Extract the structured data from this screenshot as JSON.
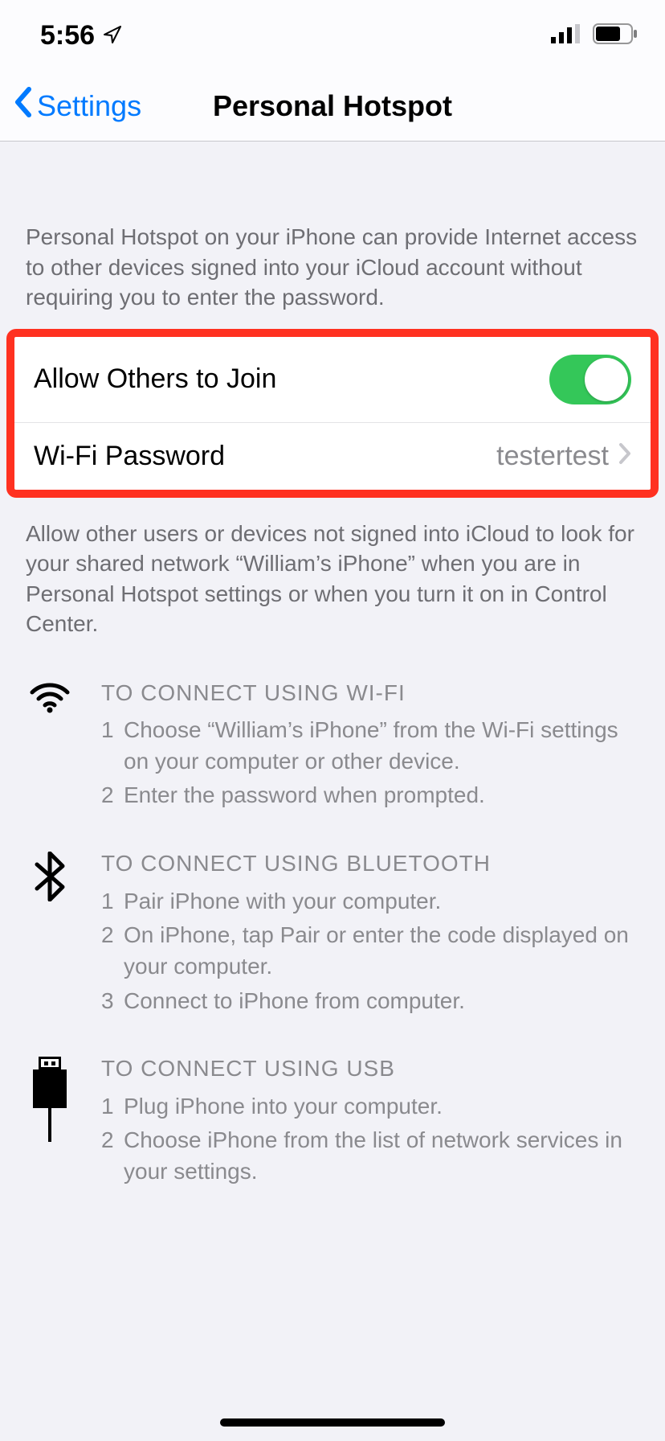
{
  "status": {
    "time": "5:56",
    "location_icon": "location-arrow"
  },
  "nav": {
    "back_label": "Settings",
    "title": "Personal Hotspot"
  },
  "intro_text": "Personal Hotspot on your iPhone can provide Internet access to other devices signed into your iCloud account without requiring you to enter the password.",
  "rows": {
    "allow_label": "Allow Others to Join",
    "allow_on": true,
    "wifi_pw_label": "Wi-Fi Password",
    "wifi_pw_value": "testertest"
  },
  "after_text": "Allow other users or devices not signed into iCloud to look for your shared network “William’s iPhone” when you are in Personal Hotspot settings or when you turn it on in Control Center.",
  "instructions": {
    "wifi": {
      "title": "TO CONNECT USING WI-FI",
      "steps": [
        "Choose “William’s iPhone” from the Wi-Fi settings on your computer or other device.",
        "Enter the password when prompted."
      ]
    },
    "bluetooth": {
      "title": "TO CONNECT USING BLUETOOTH",
      "steps": [
        "Pair iPhone with your computer.",
        "On iPhone, tap Pair or enter the code displayed on your computer.",
        "Connect to iPhone from computer."
      ]
    },
    "usb": {
      "title": "TO CONNECT USING USB",
      "steps": [
        "Plug iPhone into your computer.",
        "Choose iPhone from the list of network services in your settings."
      ]
    }
  }
}
